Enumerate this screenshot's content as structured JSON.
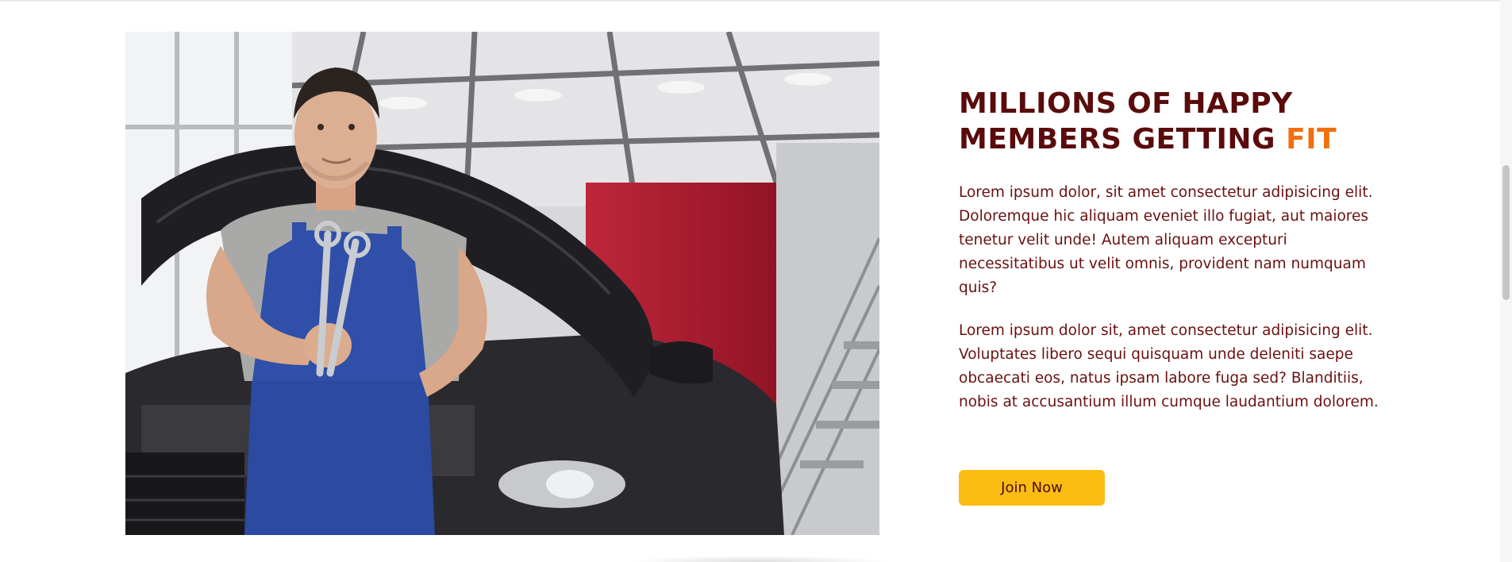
{
  "section": {
    "headline_part1": "MILLIONS OF HAPPY MEMBERS GETTING ",
    "headline_accent": "FIT",
    "paragraph1": "Lorem ipsum dolor, sit amet consectetur adipisicing elit. Doloremque hic aliquam eveniet illo fugiat, aut maiores tenetur velit unde! Autem aliquam excepturi necessitatibus ut velit omnis, provident nam numquam quis?",
    "paragraph2": "Lorem ipsum dolor sit, amet consectetur adipisicing elit. Voluptates libero sequi quisquam unde deleniti saepe obcaecati eos, natus ipsam labore fuga sed? Blanditiis, nobis at accusantium illum cumque laudantium dolorem.",
    "join_button_label": "Join Now"
  },
  "colors": {
    "headline": "#5a0b0b",
    "accent": "#f07010",
    "body_text": "#6a1010",
    "button": "#fbbd13"
  },
  "icons": {
    "hero_image": "mechanic-with-wrenches-photo"
  }
}
